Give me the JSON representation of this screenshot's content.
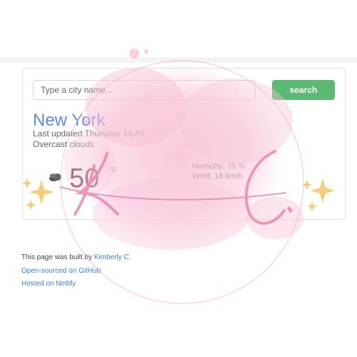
{
  "search": {
    "placeholder": "Type a city name...",
    "button_label": "search"
  },
  "weather": {
    "city": "New York",
    "last_updated": "Last updated Thursday 14:45",
    "description": "Overcast clouds",
    "temperature": "50",
    "unit": "°F",
    "humidity": "Humidity: 75 %",
    "wind": "Wind: 18 km/h",
    "icon": "overcast-clouds-icon"
  },
  "footer": {
    "built_by_prefix": "This page was built by ",
    "author": "Kimberly C.",
    "github_link": "Open-sourced on GitHub",
    "netlify_link": "Hosted on Netlify"
  },
  "watermark": {
    "signature": "Kimberly C."
  },
  "colors": {
    "accent_button": "#5cb973",
    "city_blue": "#5b8fd6",
    "link_blue": "#3b82d6",
    "watermark_pink": "#f7b6cf"
  }
}
